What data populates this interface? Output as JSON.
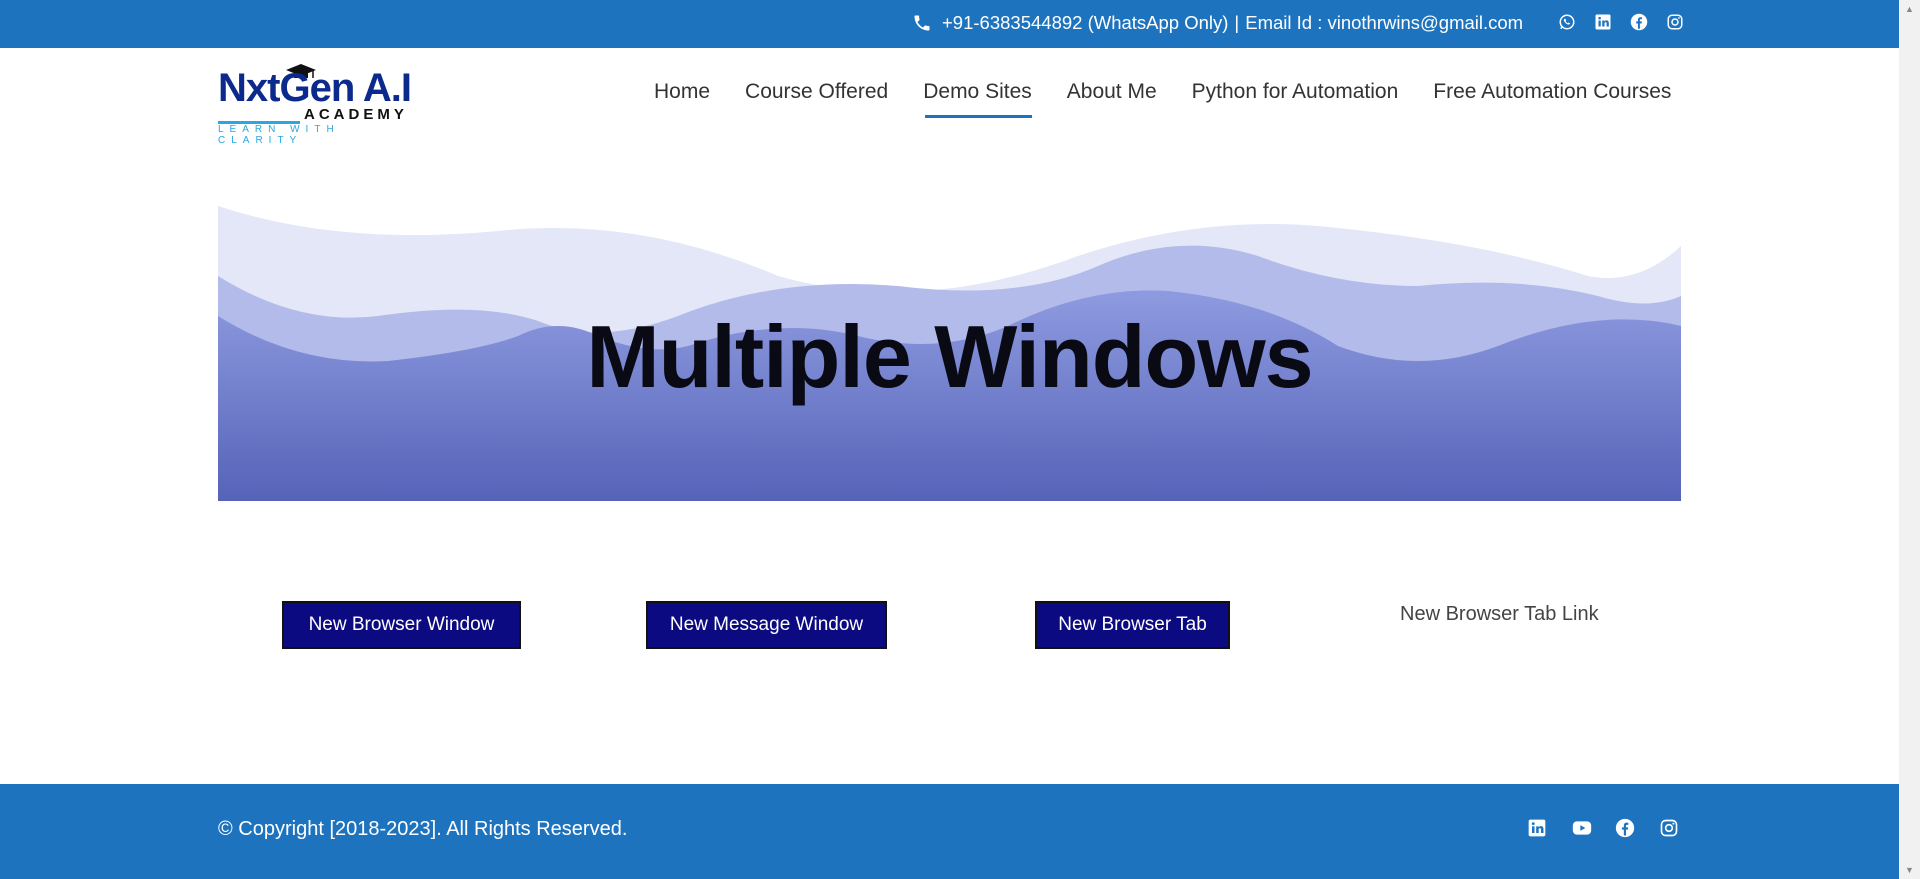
{
  "topbar": {
    "phone": "+91-6383544892 (WhatsApp Only)",
    "separator": "|",
    "email": "Email Id : vinothrwins@gmail.com",
    "social_icons": [
      "whatsapp-icon",
      "linkedin-icon",
      "facebook-icon",
      "instagram-icon"
    ]
  },
  "logo": {
    "main": "NxtGen A.I",
    "sub": "ACADEMY",
    "tagline": "LEARN WITH CLARITY"
  },
  "nav": {
    "items": [
      "Home",
      "Course Offered",
      "Demo Sites",
      "About Me",
      "Python for Automation",
      "Free Automation Courses"
    ],
    "active": "Demo Sites"
  },
  "banner": {
    "title": "Multiple Windows"
  },
  "buttons": {
    "new_browser_window": "New Browser Window",
    "new_message_window": "New Message Window",
    "new_browser_tab": "New Browser Tab",
    "new_browser_tab_link": "New Browser Tab Link"
  },
  "footer": {
    "copyright": "© Copyright [2018-2023]. All Rights Reserved.",
    "social_icons": [
      "linkedin-icon",
      "youtube-icon",
      "facebook-icon",
      "instagram-icon"
    ]
  },
  "colors": {
    "brand_blue": "#1e73be",
    "button_bg": "#0b0a80",
    "banner_top": "#e3e7f7",
    "banner_bottom": "#5866b8"
  }
}
